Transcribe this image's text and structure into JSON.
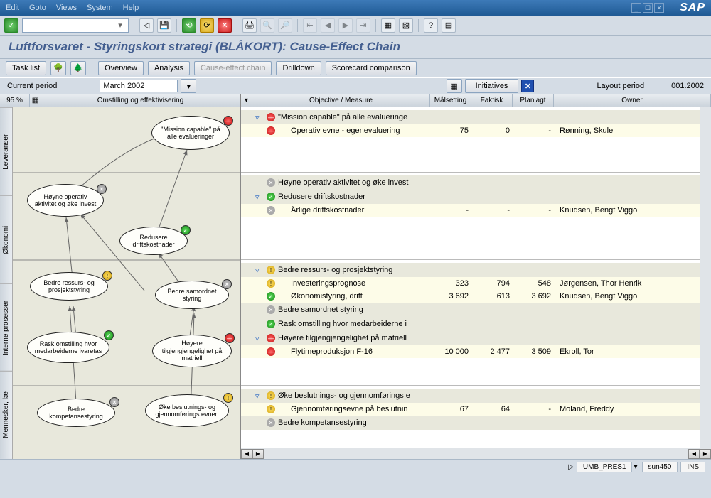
{
  "menu": {
    "edit": "Edit",
    "goto": "Goto",
    "views": "Views",
    "system": "System",
    "help": "Help"
  },
  "sap": "SAP",
  "page_title": "Luftforsvaret - Styringskort strategi (BLÅKORT): Cause-Effect Chain",
  "tb2": {
    "tasklist": "Task list",
    "overview": "Overview",
    "analysis": "Analysis",
    "cec": "Cause-effect chain",
    "drilldown": "Drilldown",
    "scorecard": "Scorecard comparison"
  },
  "period": {
    "label": "Current period",
    "value": "March 2002",
    "initiatives": "Initiatives",
    "layout_label": "Layout period",
    "layout_value": "001.2002"
  },
  "lefthdr": {
    "pct": "95 %",
    "title": "Omstilling og effektivisering"
  },
  "cols": {
    "objm": "Objective / Measure",
    "target": "Målsetting",
    "actual": "Faktisk",
    "plan": "Planlagt",
    "owner": "Owner"
  },
  "vtabs": [
    "Leveranser",
    "Økonomi",
    "Interne prosesser",
    "Mennesker, læ"
  ],
  "nodes": {
    "n1": "\"Mission capable\" på alle evalueringer",
    "n2": "Høyne operativ aktivitet og øke invest",
    "n3": "Redusere driftskostnader",
    "n4": "Bedre ressurs- og prosjektstyring",
    "n5": "Bedre samordnet styring",
    "n6": "Rask omstilling hvor medarbeiderne ivaretas",
    "n7": "Høyere tilgjengjengelighet på matriell",
    "n8": "Bedre kompetansestyring",
    "n9": "Øke beslutnings- og gjennomførings evnen"
  },
  "sections": [
    {
      "key": "s1",
      "objectives": [
        {
          "status": "red",
          "name": "\"Mission capable\" på alle evalueringe",
          "measures": [
            {
              "status": "red",
              "name": "Operativ evne - egenevaluering",
              "target": "75",
              "actual": "0",
              "plan": "-",
              "owner": "Rønning, Skule"
            }
          ]
        }
      ]
    },
    {
      "key": "s2",
      "objectives": [
        {
          "status": "gray",
          "name": "Høyne operativ aktivitet og øke invest",
          "measures": [],
          "notw": true
        },
        {
          "status": "green",
          "name": "Redusere driftskostnader",
          "measures": [
            {
              "status": "gray",
              "name": "Årlige driftskostnader",
              "target": "-",
              "actual": "-",
              "plan": "-",
              "owner": "Knudsen, Bengt Viggo"
            }
          ]
        }
      ]
    },
    {
      "key": "s3",
      "objectives": [
        {
          "status": "yellow",
          "name": "Bedre ressurs- og prosjektstyring",
          "measures": [
            {
              "status": "yellow",
              "name": "Investeringsprognose",
              "target": "323",
              "actual": "794",
              "plan": "548",
              "owner": "Jørgensen, Thor Henrik"
            },
            {
              "status": "green",
              "name": "Økonomistyring, drift",
              "target": "3 692",
              "actual": "613",
              "plan": "3 692",
              "owner": "Knudsen, Bengt Viggo"
            }
          ]
        },
        {
          "status": "gray",
          "name": "Bedre samordnet styring",
          "measures": [],
          "notw": true
        },
        {
          "status": "green",
          "name": "Rask omstilling hvor medarbeiderne i",
          "measures": [],
          "notw": true
        },
        {
          "status": "red",
          "name": "Høyere tilgjengjengelighet på matriell",
          "measures": [
            {
              "status": "red",
              "name": "Flytimeproduksjon F-16",
              "target": "10 000",
              "actual": "2 477",
              "plan": "3 509",
              "owner": "Ekroll, Tor"
            }
          ]
        }
      ]
    },
    {
      "key": "s4",
      "objectives": [
        {
          "status": "yellow",
          "name": "Øke beslutnings- og gjennomførings e",
          "measures": [
            {
              "status": "yellow",
              "name": "Gjennomføringsevne på beslutnin",
              "target": "67",
              "actual": "64",
              "plan": "-",
              "owner": "Moland, Freddy"
            }
          ]
        },
        {
          "status": "gray",
          "name": "Bedre kompetansestyring",
          "measures": [],
          "notw": true
        }
      ]
    }
  ],
  "status": {
    "f1": "UMB_PRES1",
    "f2": "sun450",
    "f3": "INS"
  }
}
